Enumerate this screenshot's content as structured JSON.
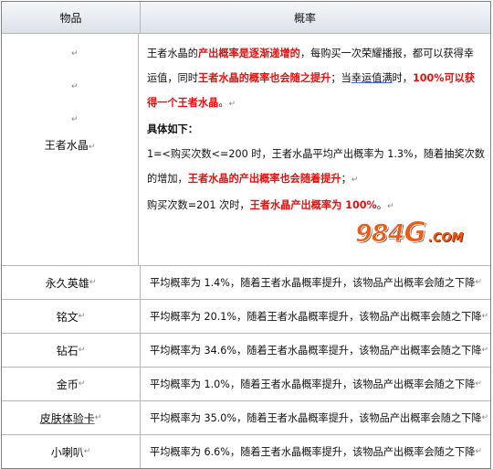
{
  "header": {
    "col_item": "物品",
    "col_rate": "概率"
  },
  "crystal": {
    "name": "王者水晶",
    "para_mark": "↵",
    "p1_a": "王者水晶的",
    "p1_b": "产出概率是逐渐递增的",
    "p1_c": "，每购买一次荣耀播报，都可以获得幸",
    "p2_a": "运值，同时",
    "p2_b": "王者水晶的概率也会随之提升",
    "p2_c": "；当",
    "p2_d": "幸运值满",
    "p2_e": "时，",
    "p2_f": "100%可以获",
    "p3_a": "得一个王者水晶",
    "p3_b": "。",
    "detail_label": "具体如下：",
    "d1": "1=<购买次数<=200 时，王者水晶平均产出概率为 1.3%，随着抽奖次数",
    "d2_a": "的增加，",
    "d2_b": "王者水晶的产出概率也会随着提升",
    "d2_c": "；",
    "d3_a": "购买次数=201 次时，",
    "d3_b": "王者水晶产出概率为 100%",
    "d3_c": "。"
  },
  "items": [
    {
      "name": "永久英雄",
      "rate": "平均概率为 1.4%，随着王者水晶概率提升，该物品产出概率会随之下降"
    },
    {
      "name": "铭文",
      "rate": "平均概率为 20.1%，随着王者水晶概率提升，该物品产出概率会随之下降"
    },
    {
      "name": "钻石",
      "rate": "平均概率为 34.6%，随着王者水晶概率提升，该物品产出概率会随之下降"
    },
    {
      "name": "金币",
      "rate": "平均概率为 1.0%，随着王者水晶概率提升，该物品产出概率会随之下降"
    },
    {
      "name": "皮肤体验卡",
      "rate": "平均概率为 35.0%，随着王者水晶概率提升，该物品产出概率会随之下降"
    },
    {
      "name": "小喇叭",
      "rate": "平均概率为 6.6%，随着王者水晶概率提升，该物品产出概率会随之下降"
    }
  ],
  "watermark": {
    "num": "984",
    "letter": "G",
    "domain": ".COM"
  }
}
